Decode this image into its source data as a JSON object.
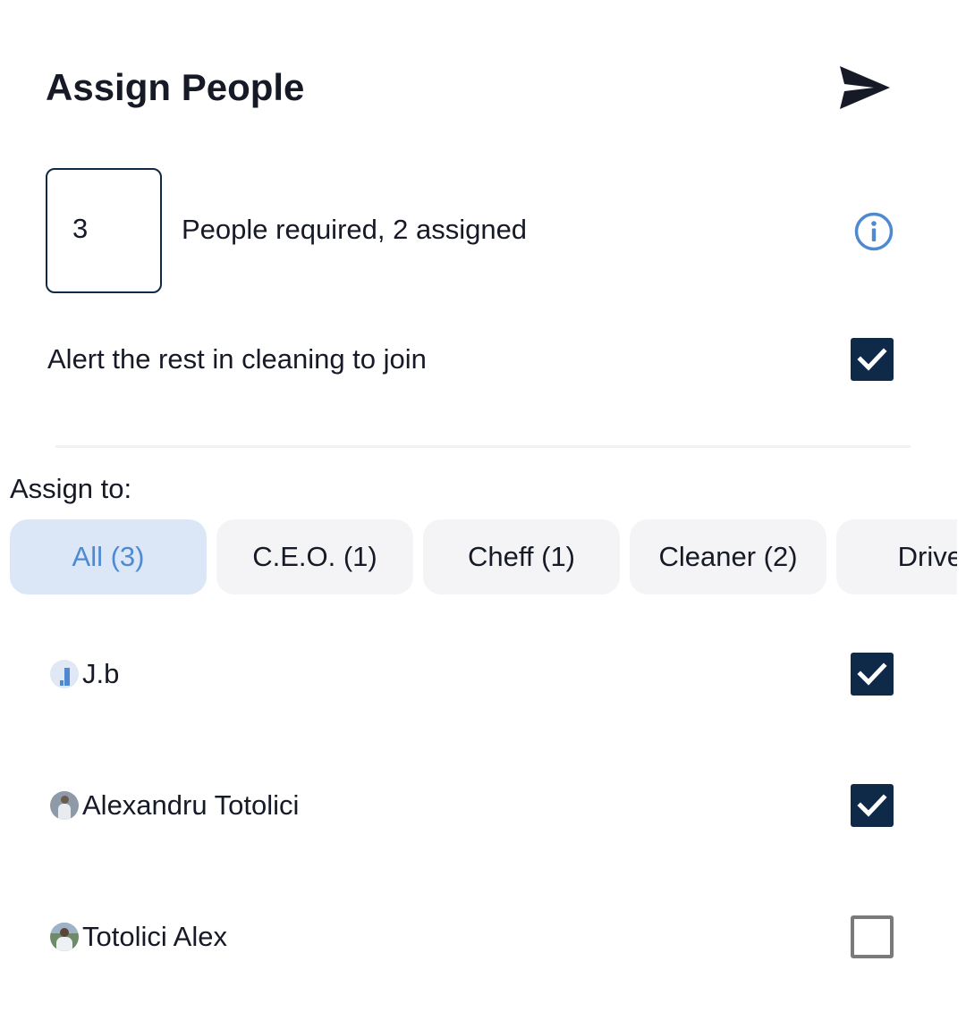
{
  "header": {
    "title": "Assign People",
    "send_icon": "send-icon"
  },
  "required": {
    "count_value": "3",
    "summary": "People required, 2 assigned",
    "info_icon": "info-icon"
  },
  "alert": {
    "label": "Alert the rest in cleaning to join",
    "checked": true
  },
  "assign": {
    "label": "Assign to:",
    "filters": [
      {
        "label": "All (3)",
        "active": true
      },
      {
        "label": "C.E.O. (1)",
        "active": false
      },
      {
        "label": "Cheff (1)",
        "active": false
      },
      {
        "label": "Cleaner (2)",
        "active": false
      },
      {
        "label": "Driver",
        "active": false
      }
    ]
  },
  "people": [
    {
      "name": "J.b",
      "checked": true
    },
    {
      "name": "Alexandru Totolici",
      "checked": true
    },
    {
      "name": "Totolici Alex",
      "checked": false
    }
  ],
  "colors": {
    "primary_dark": "#0f2a48",
    "accent_blue": "#4f8ad1",
    "chip_active_bg": "#dbe7f6",
    "chip_bg": "#f4f4f6",
    "text": "#161a26"
  }
}
